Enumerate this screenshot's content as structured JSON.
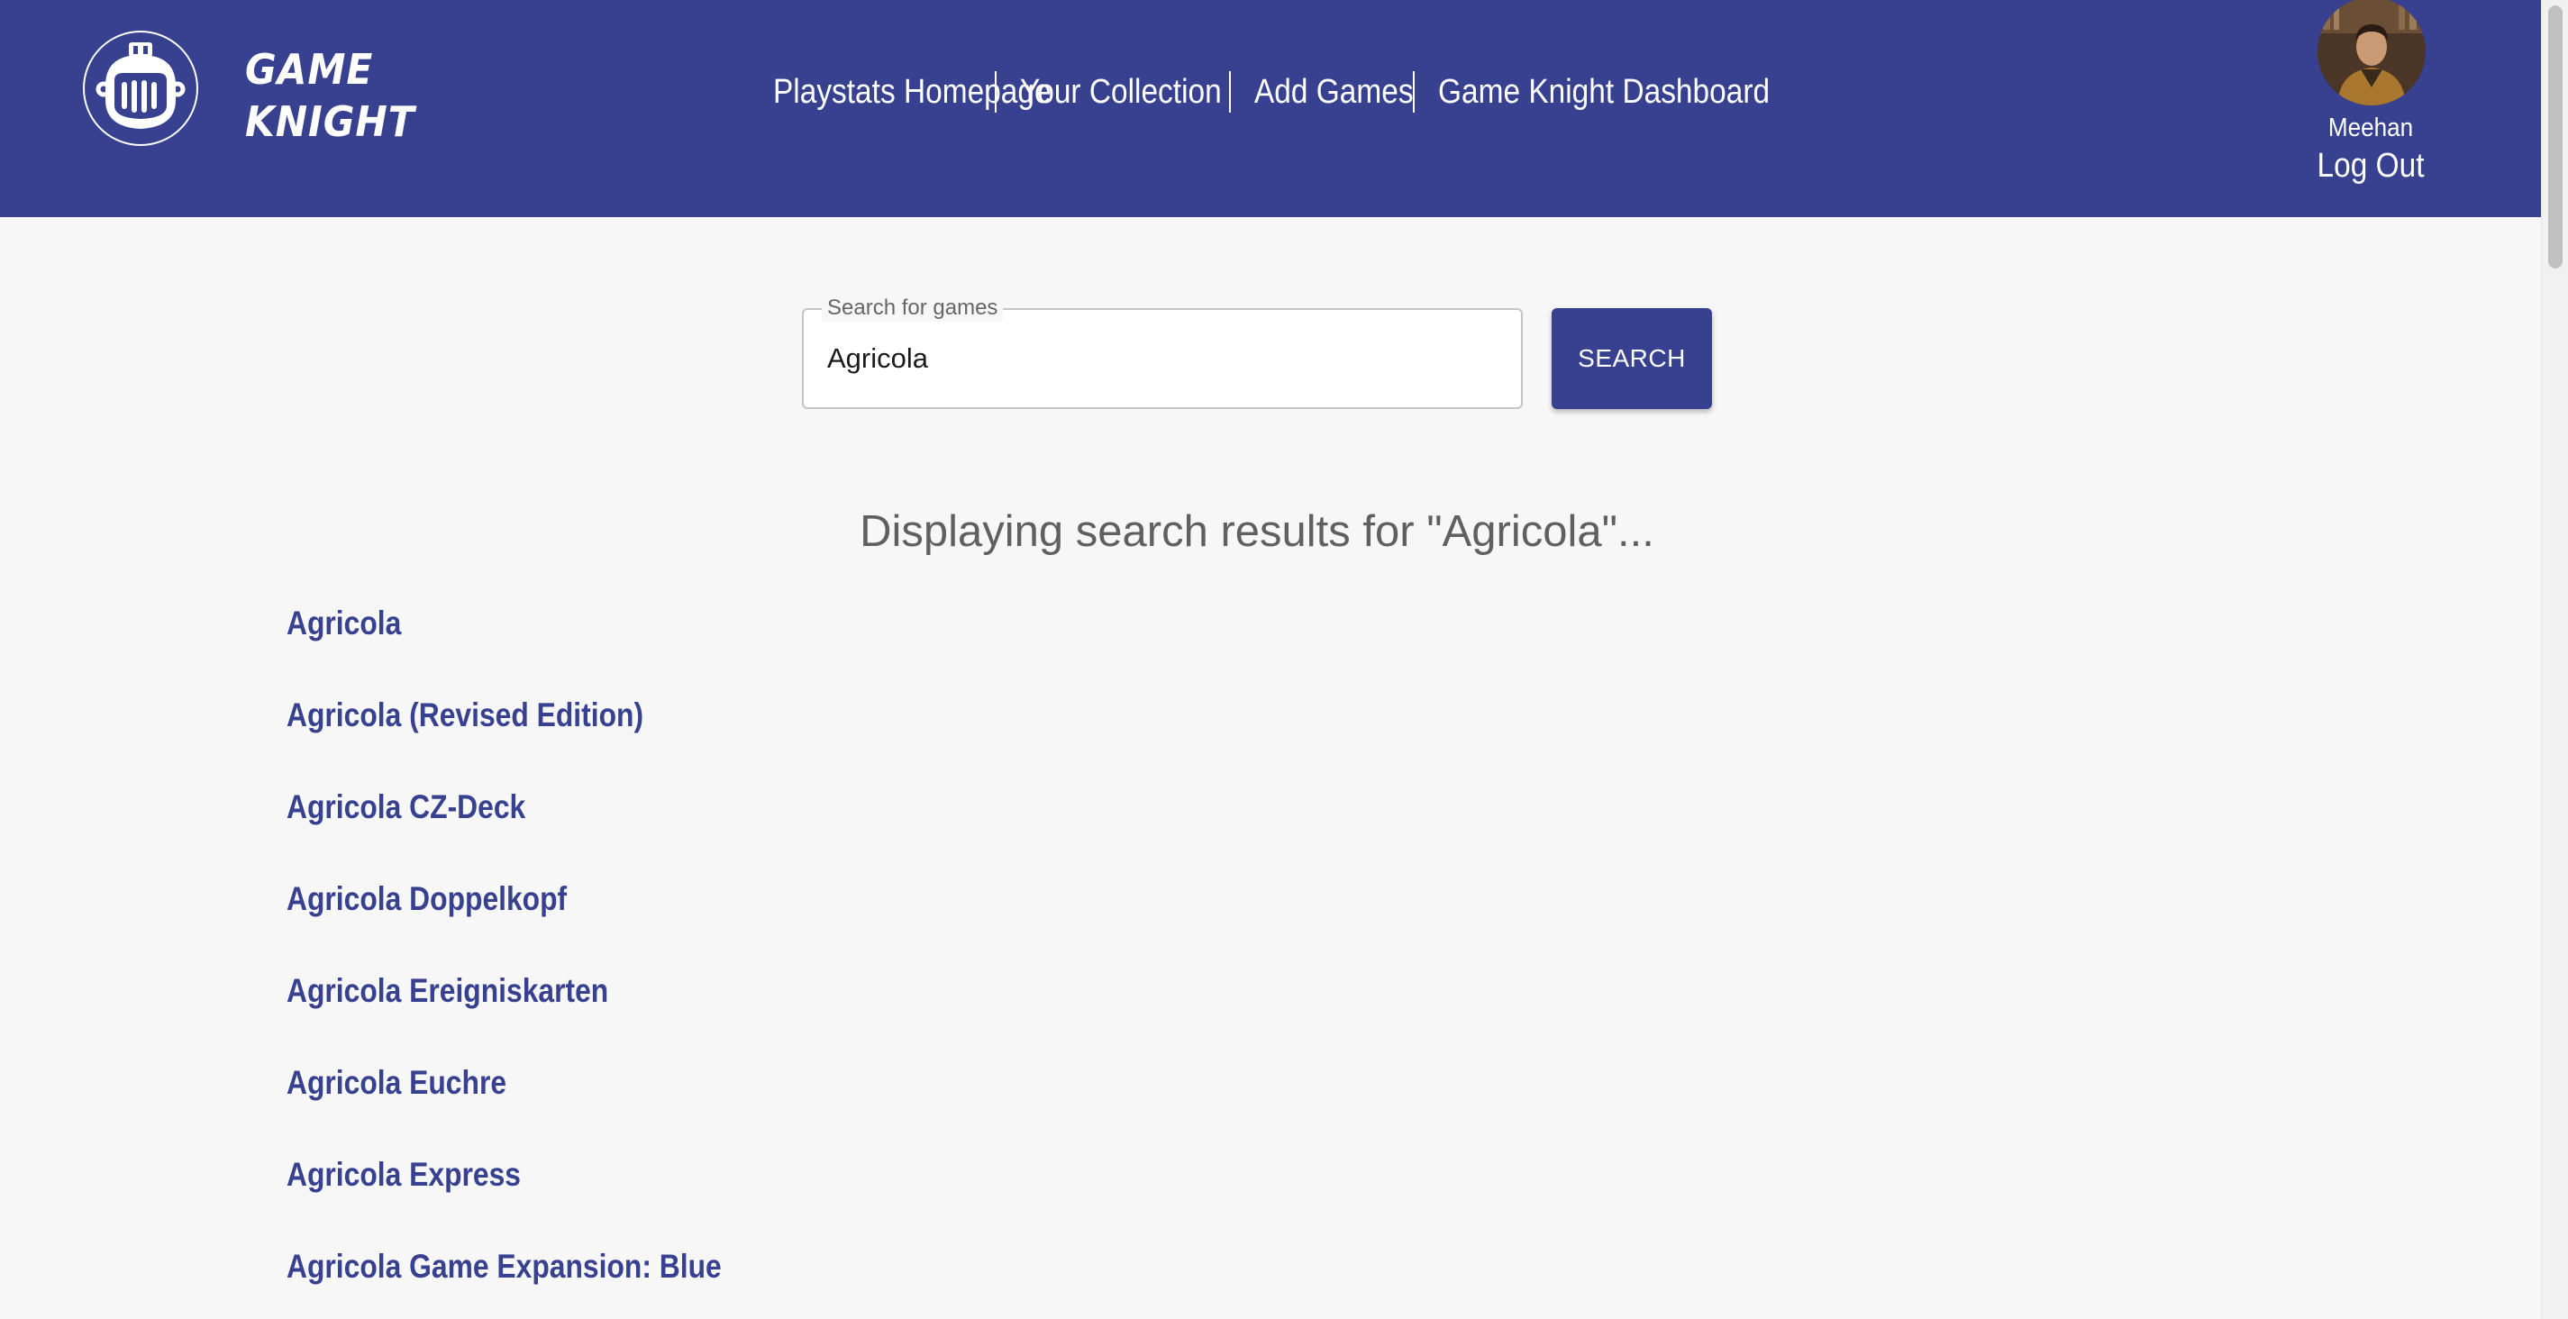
{
  "brand": {
    "line1": "GAME",
    "line2": "KNIGHT"
  },
  "nav": {
    "items": [
      {
        "label": "Playstats Homepage"
      },
      {
        "label": "Your Collection"
      },
      {
        "label": "Add Games"
      },
      {
        "label": "Game Knight Dashboard"
      }
    ]
  },
  "user": {
    "name": "Meehan",
    "logout_label": "Log Out"
  },
  "search": {
    "label": "Search for games",
    "value": "Agricola",
    "button_label": "SEARCH"
  },
  "results": {
    "heading": "Displaying search results for \"Agricola\"...",
    "items": [
      "Agricola",
      "Agricola (Revised Edition)",
      "Agricola CZ-Deck",
      "Agricola Doppelkopf",
      "Agricola Ereigniskarten",
      "Agricola Euchre",
      "Agricola Express",
      "Agricola Game Expansion: Blue"
    ]
  },
  "colors": {
    "brand": "#37418f",
    "background": "#f7f7f7",
    "heading_text": "#606060"
  },
  "icons": {
    "logo": "knight-helmet-icon"
  }
}
